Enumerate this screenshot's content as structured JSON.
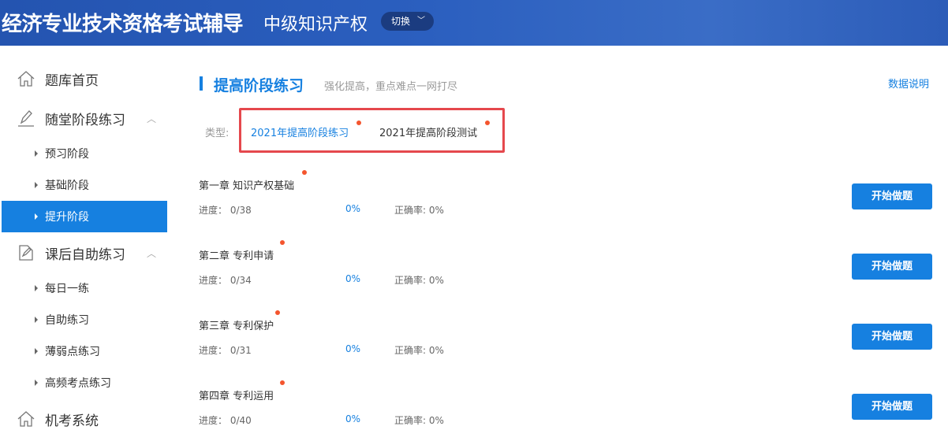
{
  "header": {
    "brand": "经济专业技术资格考试辅导",
    "subject": "中级知识产权",
    "switch_label": "切换"
  },
  "sidebar": {
    "home": "题库首页",
    "group1": {
      "label": "随堂阶段练习",
      "items": [
        "预习阶段",
        "基础阶段",
        "提升阶段"
      ]
    },
    "group2": {
      "label": "课后自助练习",
      "items": [
        "每日一练",
        "自助练习",
        "薄弱点练习",
        "高频考点练习"
      ]
    },
    "exam": "机考系统"
  },
  "main": {
    "title": "提高阶段练习",
    "subtitle": "强化提高，重点难点一网打尽",
    "data_link": "数据说明",
    "type_label": "类型:",
    "types": [
      "2021年提高阶段练习",
      "2021年提高阶段测试"
    ],
    "chapters": [
      {
        "title": "第一章 知识产权基础",
        "progress": "进度： 0/38",
        "percent": "0%",
        "accuracy": "正确率: 0%"
      },
      {
        "title": "第二章 专利申请",
        "progress": "进度： 0/34",
        "percent": "0%",
        "accuracy": "正确率: 0%"
      },
      {
        "title": "第三章 专利保护",
        "progress": "进度： 0/31",
        "percent": "0%",
        "accuracy": "正确率: 0%"
      },
      {
        "title": "第四章 专利运用",
        "progress": "进度： 0/40",
        "percent": "0%",
        "accuracy": "正确率: 0%"
      }
    ],
    "start_label": "开始做题"
  }
}
